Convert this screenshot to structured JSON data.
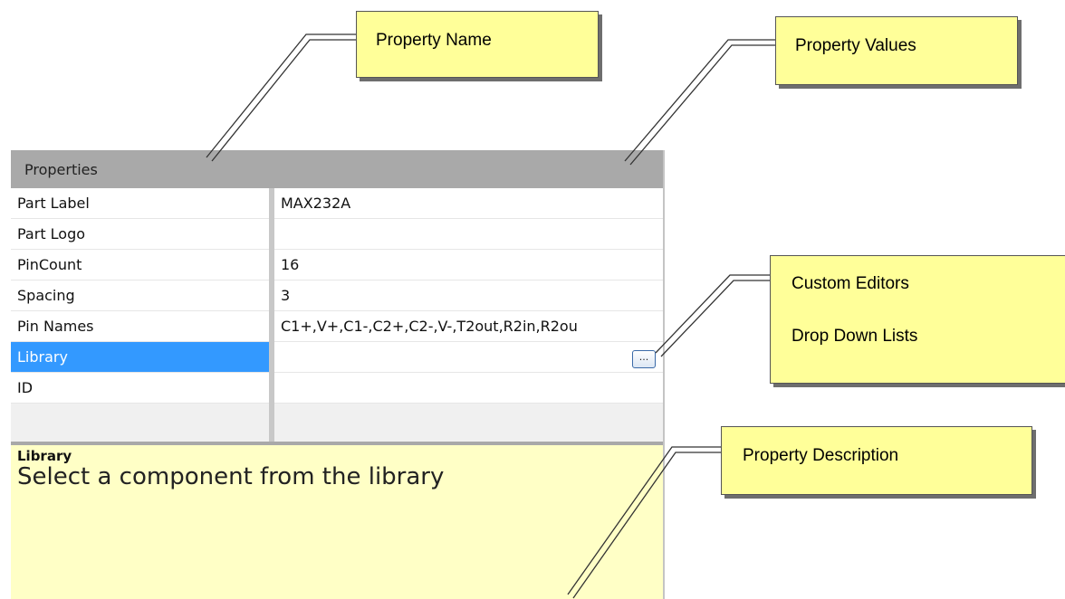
{
  "grid": {
    "header": "Properties",
    "rows": [
      {
        "name": "Part Label",
        "value": "MAX232A"
      },
      {
        "name": "Part Logo",
        "value": ""
      },
      {
        "name": "PinCount",
        "value": "16"
      },
      {
        "name": "Spacing",
        "value": "3"
      },
      {
        "name": "Pin Names",
        "value": "C1+,V+,C1-,C2+,C2-,V-,T2out,R2in,R2ou"
      },
      {
        "name": "Library",
        "value": "",
        "selected": true,
        "button": "..."
      },
      {
        "name": "ID",
        "value": ""
      }
    ],
    "description": {
      "title": "Library",
      "text": "Select a component from the library"
    }
  },
  "callouts": {
    "property_name": "Property Name",
    "property_values": "Property Values",
    "custom_editors": "Custom Editors",
    "drop_down_lists": "Drop Down Lists",
    "property_description": "Property Description"
  },
  "colors": {
    "selection": "#3399ff",
    "header": "#a9a9a9",
    "callout": "#ffff99",
    "description_bg": "#ffffc6"
  }
}
